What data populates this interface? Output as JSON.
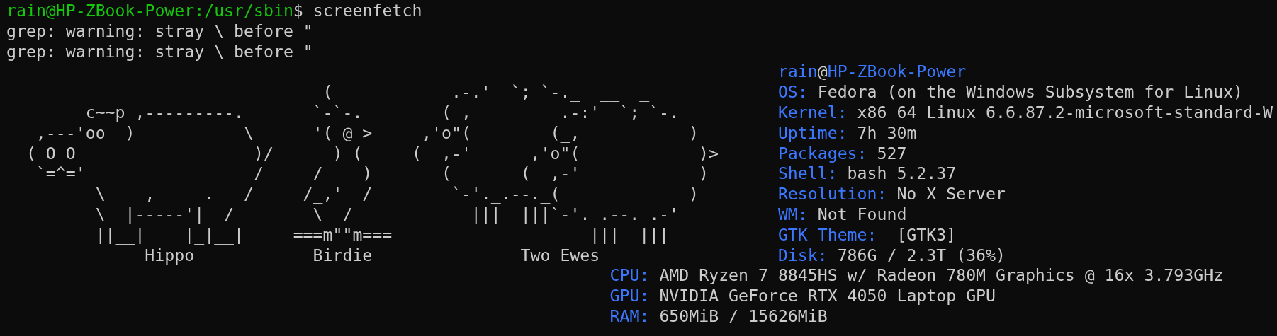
{
  "terminal": {
    "command_line": {
      "prompt": "rain@HP-ZBook-Power:/usr/sbin",
      "symbol": "$",
      "command": "screenfetch"
    },
    "output_lines": [
      "grep: warning: stray \\ before \"",
      "grep: warning: stray \\ before \""
    ],
    "ascii_art": [
      {
        "caption": "Hippo",
        "lines": [
          "      c~~p ,---------.",
          " ,---'oo  )           \\",
          "( O O                  )/",
          " `=^='                 /",
          "       \\    ,     .   /",
          "       \\  |-----'|  /",
          "       ||__|    |_|__|"
        ]
      },
      {
        "caption": "Birdie",
        "lines": [
          "   (",
          "  `-`-.",
          "  '( @ >",
          "   _) (",
          "  /    )",
          " /_,'  /",
          "  \\  /",
          "===m\"\"m==="
        ]
      },
      {
        "caption": "Two Ewes",
        "lines": [
          "         __  _",
          "    .-.'  `; `-._  __  _",
          "   (_,         .-:'  `; `-._",
          " ,'o\"(        (_,           )",
          "(__,-'      ,'o\"(            )>",
          "   (       (__,-'            )",
          "    `-'._.--._(             )",
          "      |||  |||`-'._.--._.-'",
          "                  |||  |||"
        ]
      }
    ],
    "info_header": {
      "user": "rain",
      "at": "@",
      "host": "HP-ZBook-Power"
    },
    "info": [
      {
        "kind": "column",
        "label": "OS:",
        "value": "Fedora (on the Windows Subsystem for Linux)"
      },
      {
        "kind": "column",
        "label": "Kernel:",
        "value": "x86_64 Linux 6.6.87.2-microsoft-standard-W"
      },
      {
        "kind": "column",
        "label": "Uptime:",
        "value": "7h 30m"
      },
      {
        "kind": "column",
        "label": "Packages:",
        "value": "527"
      },
      {
        "kind": "column",
        "label": "Shell:",
        "value": "bash 5.2.37"
      },
      {
        "kind": "column",
        "label": "Resolution:",
        "value": "No X Server"
      },
      {
        "kind": "column",
        "label": "WM:",
        "value": "Not Found"
      },
      {
        "kind": "column",
        "label": "GTK Theme:",
        "value": " [GTK3]"
      },
      {
        "kind": "column",
        "label": "Disk:",
        "value": "786G / 2.3T (36%)"
      },
      {
        "kind": "wide",
        "label": "CPU:",
        "value": "AMD Ryzen 7 8845HS w/ Radeon 780M Graphics @ 16x 3.793GHz"
      },
      {
        "kind": "wide",
        "label": "GPU:",
        "value": "NVIDIA GeForce RTX 4050 Laptop GPU"
      },
      {
        "kind": "wide",
        "label": "RAM:",
        "value": "650MiB / 15626MiB"
      }
    ]
  }
}
